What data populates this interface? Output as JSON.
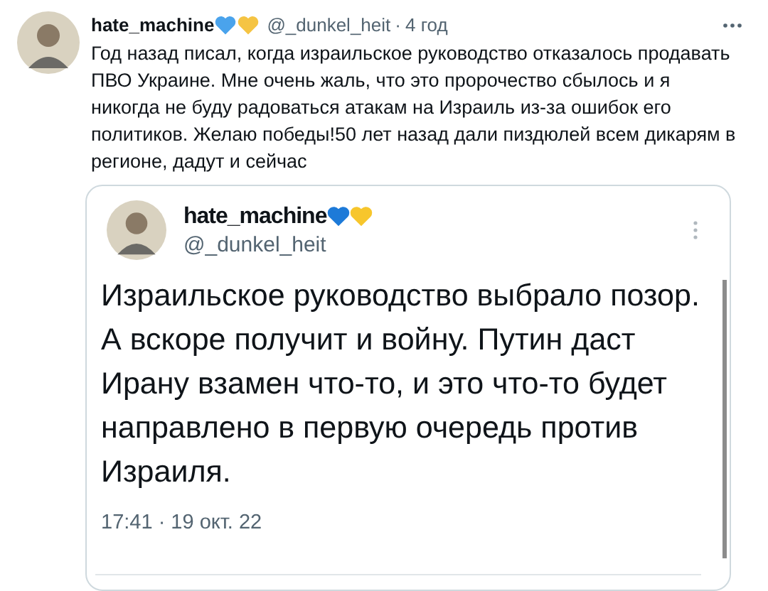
{
  "tweet": {
    "name": "hate_machine",
    "handle": "@_dunkel_heit",
    "separator": "·",
    "time": "4 год",
    "text": "Год назад писал, когда израильское руководство отказалось продавать ПВО Украине. Мне очень жаль, что это пророчество сбылось и я никогда не буду радоваться атакам на Израиль из-за ошибок его политиков. Желаю победы!50 лет назад дали пиздюлей всем дикарям в регионе, дадут и сейчас"
  },
  "quoted": {
    "name": "hate_machine",
    "handle": "@_dunkel_heit",
    "text": "Израильское руководство выбрало позор. А вскоре получит и войну. Путин даст Ирану взамен что-то, и это что-то будет направлено в первую очередь против Израиля.",
    "timestamp": "17:41 · 19 окт. 22"
  }
}
